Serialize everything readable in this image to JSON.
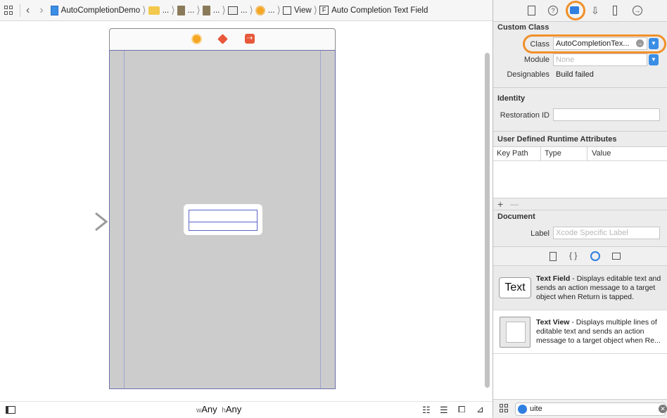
{
  "jumpbar": {
    "project": "AutoCompletionDemo",
    "ellipsis": "...",
    "view": "View",
    "f_badge": "F",
    "current": "Auto Completion Text Field"
  },
  "canvas": {
    "size_class_w_prefix": "w",
    "size_class_w": "Any",
    "size_class_h_prefix": "h",
    "size_class_h": "Any"
  },
  "inspector": {
    "custom_class": {
      "title": "Custom Class",
      "class_label": "Class",
      "class_value": "AutoCompletionTex...",
      "module_label": "Module",
      "module_placeholder": "None",
      "designables_label": "Designables",
      "designables_value": "Build failed"
    },
    "identity": {
      "title": "Identity",
      "restoration_label": "Restoration ID",
      "restoration_value": ""
    },
    "runtime_attributes": {
      "title": "User Defined Runtime Attributes",
      "columns": [
        "Key Path",
        "Type",
        "Value"
      ],
      "add": "+",
      "remove": "—"
    },
    "document": {
      "title": "Document",
      "label_label": "Label",
      "label_placeholder": "Xcode Specific Label"
    }
  },
  "library": {
    "items": [
      {
        "thumb": "Text",
        "name": "Text Field",
        "desc": " - Displays editable text and sends an action message to a target object when Return is tapped."
      },
      {
        "thumb": "",
        "name": "Text View",
        "desc": " - Displays multiple lines of editable text and sends an action message to a target object when Re..."
      }
    ],
    "filter_value": "uite"
  },
  "colors": {
    "accent_blue": "#3a8ee6",
    "highlight_orange": "#f0902a",
    "scene_bg": "#cccccc"
  }
}
